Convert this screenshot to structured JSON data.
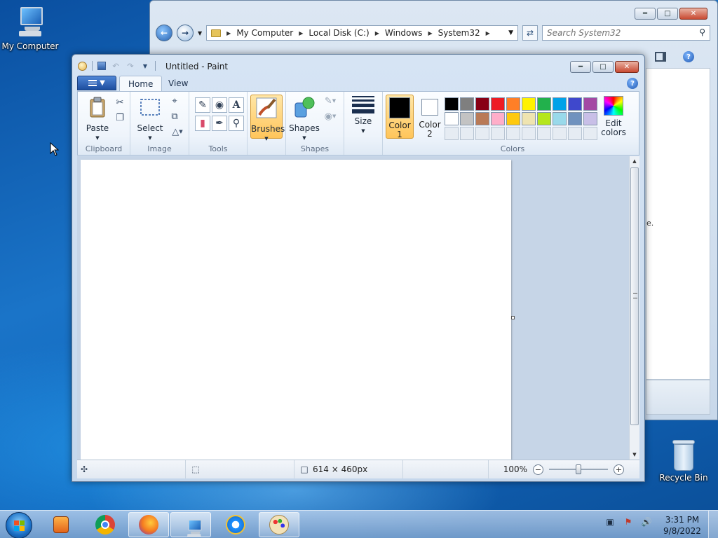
{
  "desktop": {
    "icons": [
      {
        "label": "My Computer"
      },
      {
        "label": "Recycle Bin"
      }
    ]
  },
  "explorer": {
    "breadcrumb": [
      "My Computer",
      "Local Disk (C:)",
      "Windows",
      "System32"
    ],
    "search_placeholder": "Search System32",
    "content_trail": "e."
  },
  "paint": {
    "window_title": "Untitled - Paint",
    "tabs": {
      "home": "Home",
      "view": "View"
    },
    "ribbon": {
      "clipboard": {
        "label": "Clipboard",
        "paste": "Paste"
      },
      "image": {
        "label": "Image",
        "select": "Select"
      },
      "tools": {
        "label": "Tools"
      },
      "brushes": "Brushes",
      "shapes": {
        "label": "Shapes",
        "button": "Shapes"
      },
      "size": "Size",
      "colors": {
        "label": "Colors",
        "color1": {
          "l1": "Color",
          "l2": "1",
          "value": "#000000"
        },
        "color2": {
          "l1": "Color",
          "l2": "2",
          "value": "#ffffff"
        },
        "edit_l1": "Edit",
        "edit_l2": "colors",
        "palette_row1": [
          "#000000",
          "#7f7f7f",
          "#880015",
          "#ed1c24",
          "#ff7f27",
          "#fff200",
          "#22b14c",
          "#00a2e8",
          "#3f48cc",
          "#a349a4"
        ],
        "palette_row2": [
          "#ffffff",
          "#c3c3c3",
          "#b97a57",
          "#ffaec9",
          "#ffc90e",
          "#efe4b0",
          "#b5e61d",
          "#99d9ea",
          "#7092be",
          "#c8bfe7"
        ]
      }
    },
    "status": {
      "dimensions": "614 × 460px",
      "zoom": "100%"
    }
  },
  "taskbar": {
    "clock_time": "3:31 PM",
    "clock_date": "9/8/2022"
  }
}
